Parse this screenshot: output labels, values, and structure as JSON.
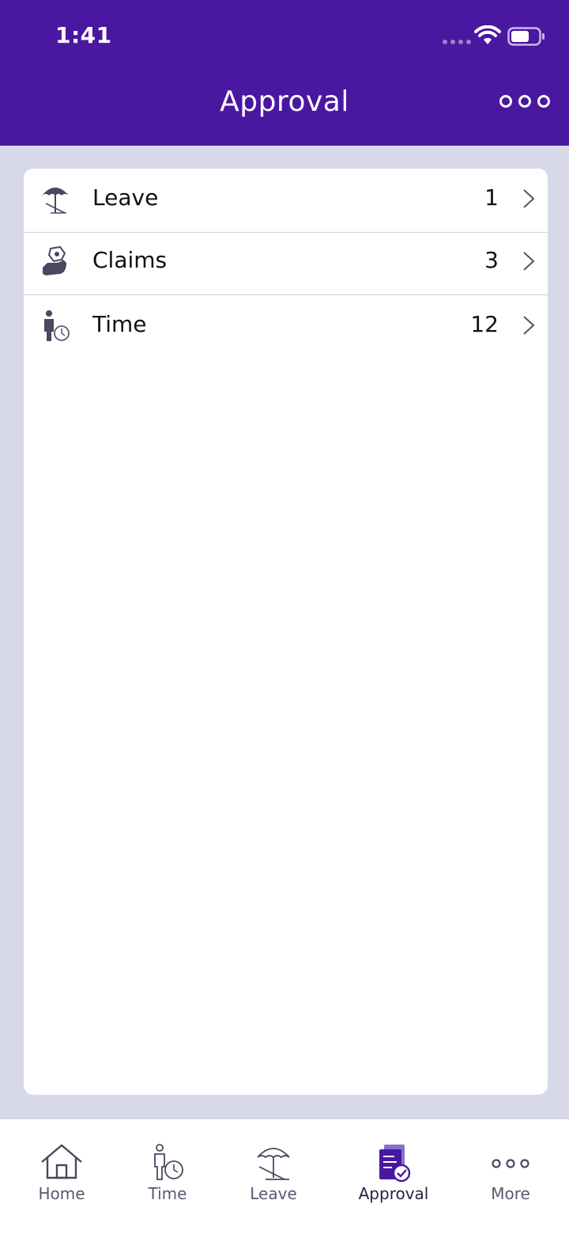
{
  "status_bar": {
    "time": "1:41"
  },
  "header": {
    "title": "Approval",
    "menu_icon": "more-dots-icon"
  },
  "colors": {
    "brand": "#4a17a0",
    "background": "#d8d9e8",
    "icon": "#4a4860",
    "active_tab": "#4a17a0"
  },
  "approvals": [
    {
      "label": "Leave",
      "count": "1",
      "icon": "umbrella-icon"
    },
    {
      "label": "Claims",
      "count": "3",
      "icon": "money-hand-icon"
    },
    {
      "label": "Time",
      "count": "12",
      "icon": "person-clock-icon"
    }
  ],
  "tabs": [
    {
      "label": "Home",
      "icon": "home-icon",
      "active": false
    },
    {
      "label": "Time",
      "icon": "person-clock-icon",
      "active": false
    },
    {
      "label": "Leave",
      "icon": "umbrella-icon",
      "active": false
    },
    {
      "label": "Approval",
      "icon": "approval-document-icon",
      "active": true
    },
    {
      "label": "More",
      "icon": "more-dots-icon",
      "active": false
    }
  ]
}
